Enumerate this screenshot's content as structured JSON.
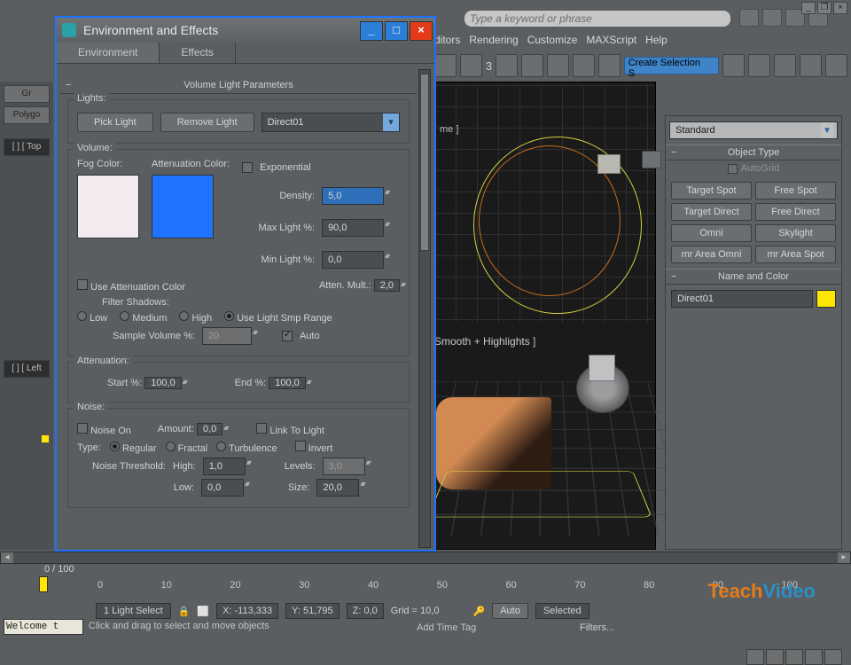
{
  "app": {
    "search_placeholder": "Type a keyword or phrase"
  },
  "menu": {
    "items": [
      "ditors",
      "Rendering",
      "Customize",
      "MAXScript",
      "Help"
    ]
  },
  "toolbar": {
    "selection_set": "Create Selection S"
  },
  "viewport": {
    "top_label": "me ]",
    "persp_label": "Smooth + Highlights ]"
  },
  "cmdpanel": {
    "category": "Standard",
    "rollout_objtype": "Object Type",
    "autogrid": "AutoGrid",
    "buttons": [
      "Target Spot",
      "Free Spot",
      "Target Direct",
      "Free Direct",
      "Omni",
      "Skylight",
      "mr Area Omni",
      "mr Area Spot"
    ],
    "rollout_name": "Name and Color",
    "name_value": "Direct01"
  },
  "dialog": {
    "title": "Environment and Effects",
    "tabs": [
      "Environment",
      "Effects"
    ],
    "rollup": "Volume Light Parameters",
    "lights": {
      "label": "Lights:",
      "pick": "Pick Light",
      "remove": "Remove Light",
      "selected": "Direct01"
    },
    "volume": {
      "label": "Volume:",
      "fog": "Fog Color:",
      "atten": "Attenuation Color:",
      "exp": "Exponential",
      "density_l": "Density:",
      "density_v": "5,0",
      "maxlight_l": "Max Light %:",
      "maxlight_v": "90,0",
      "minlight_l": "Min Light %:",
      "minlight_v": "0,0",
      "attmult_l": "Atten. Mult.:",
      "attmult_v": "2,0",
      "use_atten": "Use Attenuation Color",
      "filter_l": "Filter Shadows:",
      "filter_low": "Low",
      "filter_med": "Medium",
      "filter_high": "High",
      "filter_smp": "Use Light Smp Range",
      "sample_l": "Sample Volume %:",
      "sample_v": "20",
      "auto": "Auto",
      "fog_hex": "#f3eaf0",
      "atten_hex": "#1f74ff"
    },
    "attenuation": {
      "label": "Attenuation:",
      "start_l": "Start %:",
      "start_v": "100,0",
      "end_l": "End %:",
      "end_v": "100,0"
    },
    "noise": {
      "label": "Noise:",
      "on": "Noise On",
      "amount_l": "Amount:",
      "amount_v": "0,0",
      "link": "Link To Light",
      "type_l": "Type:",
      "t_reg": "Regular",
      "t_frac": "Fractal",
      "t_turb": "Turbulence",
      "invert": "Invert",
      "nt_l": "Noise Threshold:",
      "high_l": "High:",
      "high_v": "1,0",
      "levels_l": "Levels:",
      "levels_v": "3,0",
      "low_l": "Low:",
      "low_v": "0,0",
      "size_l": "Size:",
      "size_v": "20,0"
    }
  },
  "timeline": {
    "frames": "0 / 100",
    "ticks": [
      "0",
      "10",
      "20",
      "30",
      "40",
      "50",
      "60",
      "70",
      "80",
      "90",
      "100"
    ],
    "selection": "1 Light Select",
    "x": "X: -113,333",
    "y": "Y: 51,795",
    "z": "Z: 0,0",
    "grid": "Grid = 10,0",
    "auto": "Auto",
    "selected": "Selected",
    "add_tag": "Add Time Tag",
    "prompt": "Click and drag to select and move objects",
    "welcome": "Welcome t",
    "filter": "Filters..."
  },
  "watermark": {
    "p1": "Teach",
    "p2": "Video"
  },
  "left": {
    "tab1": "Gr",
    "tab2": "Polygo",
    "vp1": "[ ] [ Top",
    "vp2": "[ ] [ Left"
  }
}
